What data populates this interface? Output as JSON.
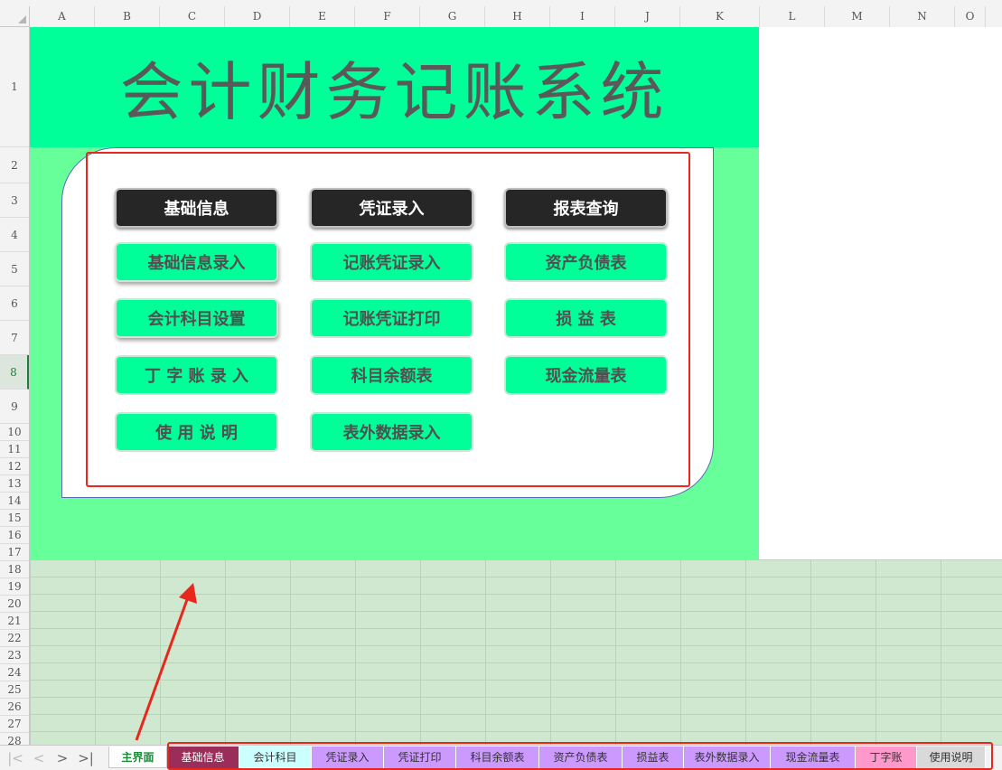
{
  "sheet": {
    "columns": [
      "A",
      "B",
      "C",
      "D",
      "E",
      "F",
      "G",
      "H",
      "I",
      "J",
      "K",
      "L",
      "M",
      "N",
      "O"
    ],
    "rows": [
      "1",
      "2",
      "3",
      "4",
      "5",
      "6",
      "7",
      "8",
      "9",
      "10",
      "11",
      "12",
      "13",
      "14",
      "15",
      "16",
      "17",
      "18",
      "19",
      "20",
      "21",
      "22",
      "23",
      "24",
      "25",
      "26",
      "27",
      "28"
    ],
    "selected_row": "8"
  },
  "title": "会计财务记账系统",
  "menu": {
    "basic": {
      "header": "基础信息",
      "items": [
        "基础信息录入",
        "会计科目设置",
        "丁 字 账 录 入",
        "使 用 说 明"
      ]
    },
    "voucher": {
      "header": "凭证录入",
      "items": [
        "记账凭证录入",
        "记账凭证打印",
        "科目余额表",
        "表外数据录入"
      ]
    },
    "report": {
      "header": "报表查询",
      "items": [
        "资产负债表",
        "损 益 表",
        "现金流量表"
      ]
    }
  },
  "tabs": [
    {
      "label": "主界面",
      "color": "#ffffff"
    },
    {
      "label": "基础信息",
      "color": "#9b2d5a"
    },
    {
      "label": "会计科目",
      "color": "#ccffff"
    },
    {
      "label": "凭证录入",
      "color": "#cc99ff"
    },
    {
      "label": "凭证打印",
      "color": "#cc99ff"
    },
    {
      "label": "科目余额表",
      "color": "#cc99ff"
    },
    {
      "label": "资产负债表",
      "color": "#cc99ff"
    },
    {
      "label": "损益表",
      "color": "#cc99ff"
    },
    {
      "label": "表外数据录入",
      "color": "#cc99ff"
    },
    {
      "label": "现金流量表",
      "color": "#cc99ff"
    },
    {
      "label": "丁字账",
      "color": "#ff99cc"
    },
    {
      "label": "使用说明",
      "color": "#d9d9d9"
    }
  ],
  "icons": {
    "nav_first": "first-sheet-icon",
    "nav_prev": "prev-sheet-icon",
    "nav_next": "next-sheet-icon",
    "nav_last": "last-sheet-icon"
  },
  "colors": {
    "title_band": "#00ff99",
    "panel_area": "#66ff99",
    "button": "#00ff99",
    "header_button": "#262626",
    "highlight": "#e8281e"
  }
}
